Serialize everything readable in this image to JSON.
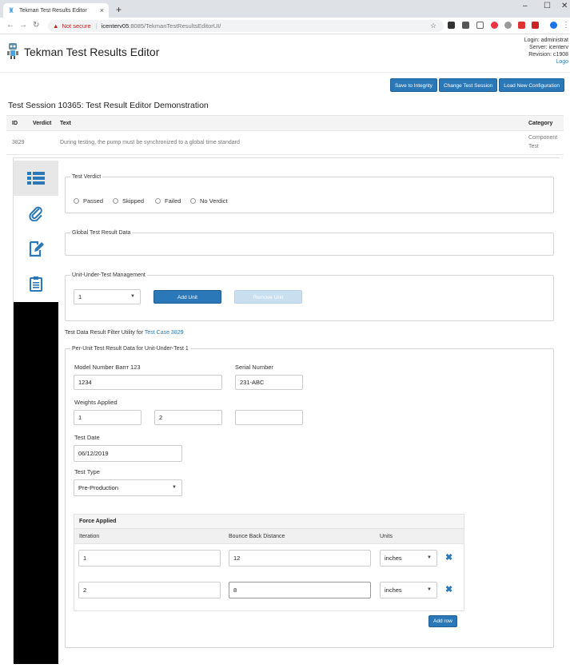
{
  "browser": {
    "tab_title": "Tekman Test Results Editor",
    "tab_close": "×",
    "new_tab": "+",
    "not_secure": "Not secure",
    "url_host": "icenterv05",
    "url_path": ":8085/TekmanTestResultsEditorUI/",
    "win_min": "–",
    "win_max": "☐",
    "win_close": "✕"
  },
  "header": {
    "app_title": "Tekman Test Results Editor",
    "login": "Login: administrat",
    "server": "Server: icenterv",
    "revision": "Revision: c1908",
    "logout": "Logo"
  },
  "toolbar": {
    "save": "Save to Integrity",
    "change": "Change Test Session",
    "load": "Load New Configuration"
  },
  "session_title": "Test Session 10365: Test Result Editor Demonstration",
  "table": {
    "headers": {
      "id": "ID",
      "verdict": "Verdict",
      "text": "Text",
      "category": "Category"
    },
    "row": {
      "id": "3829",
      "verdict": "",
      "text": "During testing, the pump must be synchronized to a global time standard",
      "category_line1": "Component",
      "category_line2": "Test"
    }
  },
  "verdict": {
    "legend": "Test Verdict",
    "options": [
      "Passed",
      "Skipped",
      "Failed",
      "No Verdict"
    ]
  },
  "global_data": {
    "legend": "Global Test Result Data"
  },
  "uut": {
    "legend": "Unit-Under-Test Management",
    "selected_unit": "1",
    "add_unit": "Add Unit",
    "remove_unit": "Remove Unit"
  },
  "filter": {
    "prefix": "Test Data Result Filter Utility for",
    "link": "Test Case 3829"
  },
  "per_unit": {
    "legend": "Per-Unit Test Result Data for Unit-Under-Test 1",
    "model_label": "Model Number Barrr 123",
    "model_value": "1234",
    "serial_label": "Serial Number",
    "serial_value": "231-ABC",
    "weights_label": "Weights Applied",
    "weights": [
      "1",
      "2",
      ""
    ],
    "date_label": "Test Date",
    "date_value": "06/12/2019",
    "type_label": "Test Type",
    "type_value": "Pre-Production"
  },
  "force": {
    "title": "Force Applied",
    "columns": {
      "iteration": "Iteration",
      "bounce": "Bounce Back Distance",
      "units": "Units"
    },
    "rows": [
      {
        "iteration": "1",
        "bounce": "12",
        "units": "inches"
      },
      {
        "iteration": "2",
        "bounce": "8",
        "units": "inches"
      }
    ],
    "add_row": "Add row"
  },
  "colors": {
    "primary": "#2a78b8",
    "disabled": "#c9dff0",
    "link": "#2a7bbf",
    "sidebar_bg": "#000000"
  },
  "icons": [
    "list-icon",
    "paperclip-icon",
    "edit-document-icon",
    "clipboard-icon",
    "remove-row-icon"
  ]
}
